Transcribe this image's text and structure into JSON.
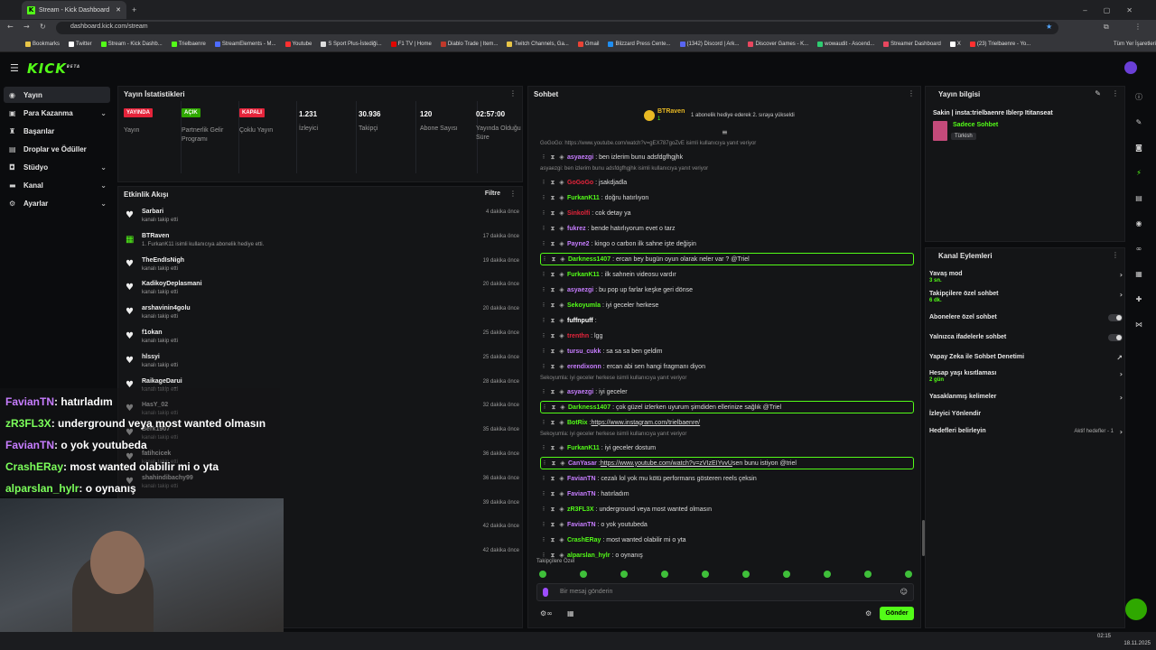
{
  "browser": {
    "tab_title": "Stream - Kick Dashboard",
    "url": "dashboard.kick.com/stream",
    "bookmarks": [
      {
        "label": "Bookmarks",
        "color": "#e8c547"
      },
      {
        "label": "Twitter",
        "color": "#ffffff"
      },
      {
        "label": "Stream - Kick Dashb...",
        "color": "#53fc18"
      },
      {
        "label": "Trielbaenre",
        "color": "#53fc18"
      },
      {
        "label": "StreamElements - M...",
        "color": "#4d6cff"
      },
      {
        "label": "Youtube",
        "color": "#ff3030"
      },
      {
        "label": "S Sport Plus-İstediği...",
        "color": "#dddddd"
      },
      {
        "label": "F1 TV | Home",
        "color": "#e10600"
      },
      {
        "label": "Diablo Trade | Item...",
        "color": "#c0392b"
      },
      {
        "label": "Twitch Channels, Ga...",
        "color": "#e8c547"
      },
      {
        "label": "Gmail",
        "color": "#ea4335"
      },
      {
        "label": "Blizzard Press Cente...",
        "color": "#1f8ef1"
      },
      {
        "label": "(1342) Discord | Ark...",
        "color": "#5865f2"
      },
      {
        "label": "Discover Games - K...",
        "color": "#e8475f"
      },
      {
        "label": "wowaudit - Ascend...",
        "color": "#2ecc71"
      },
      {
        "label": "Streamer Dashboard",
        "color": "#e8475f"
      },
      {
        "label": "X",
        "color": "#ffffff"
      },
      {
        "label": "(23) Trielbaenre - Yo...",
        "color": "#ff3030"
      }
    ],
    "all_bookmarks": "Tüm Yer İşaretleri"
  },
  "brand": {
    "logo": "KICK",
    "logo_sup": "BETA",
    "accent": "#53fc18"
  },
  "sidebar": [
    {
      "label": "Yayın",
      "icon": "broadcast-icon",
      "chevron": false,
      "active": true
    },
    {
      "label": "Para Kazanma",
      "icon": "money-icon",
      "chevron": true
    },
    {
      "label": "Başarılar",
      "icon": "trophy-icon",
      "chevron": false
    },
    {
      "label": "Droplar ve Ödüller",
      "icon": "gift-icon",
      "chevron": false
    },
    {
      "label": "Stüdyo",
      "icon": "camera-icon",
      "chevron": true
    },
    {
      "label": "Kanal",
      "icon": "channel-icon",
      "chevron": true
    },
    {
      "label": "Ayarlar",
      "icon": "gear-icon",
      "chevron": true
    }
  ],
  "stats": {
    "title": "Yayın İstatistikleri",
    "items": [
      {
        "badge": "YAYINDA",
        "badge_color": "#e5243b",
        "label": "Yayın"
      },
      {
        "badge": "AÇIK",
        "badge_color": "#2fa800",
        "label": "Partnerlik Gelir Programı"
      },
      {
        "badge": "KAPALI",
        "badge_color": "#e5243b",
        "label": "Çoklu Yayın"
      },
      {
        "value": "1.231",
        "label": "İzleyici"
      },
      {
        "value": "30.936",
        "label": "Takipçi"
      },
      {
        "value": "120",
        "label": "Abone Sayısı"
      },
      {
        "value": "02:57:00",
        "label": "Yayında Olduğu Süre"
      }
    ]
  },
  "activity": {
    "title": "Etkinlik Akışı",
    "filter": "Filtre",
    "items": [
      {
        "name": "Sarbari",
        "sub": "kanalı takip etti",
        "time": "4 dakika önce",
        "icon": "heart"
      },
      {
        "name": "BTRaven",
        "sub": "1. FurkanK11 isimli kullanıcıya abonelik hediye etti.",
        "time": "17 dakika önce",
        "icon": "gift"
      },
      {
        "name": "TheEndIsNigh",
        "sub": "kanalı takip etti",
        "time": "19 dakika önce",
        "icon": "heart"
      },
      {
        "name": "KadikoyDeplasmani",
        "sub": "kanalı takip etti",
        "time": "20 dakika önce",
        "icon": "heart"
      },
      {
        "name": "arshavinin4golu",
        "sub": "kanalı takip etti",
        "time": "20 dakika önce",
        "icon": "heart"
      },
      {
        "name": "f1okan",
        "sub": "kanalı takip etti",
        "time": "25 dakika önce",
        "icon": "heart"
      },
      {
        "name": "hlssyi",
        "sub": "kanalı takip etti",
        "time": "25 dakika önce",
        "icon": "heart"
      },
      {
        "name": "RaikageDarui",
        "sub": "kanalı takip etti",
        "time": "28 dakika önce",
        "icon": "heart"
      },
      {
        "name": "HasY_02",
        "sub": "kanalı takip etti",
        "time": "32 dakika önce",
        "icon": "heart"
      },
      {
        "name": "Berk1907",
        "sub": "kanalı takip etti",
        "time": "35 dakika önce",
        "icon": "heart"
      },
      {
        "name": "fatihcicek",
        "sub": "kanalı takip etti",
        "time": "36 dakika önce",
        "icon": "heart"
      },
      {
        "name": "shahindibachy99",
        "sub": "kanalı takip etti",
        "time": "36 dakika önce",
        "icon": "heart"
      },
      {
        "name": "",
        "sub": "",
        "time": "39 dakika önce",
        "icon": "heart"
      },
      {
        "name": "",
        "sub": "",
        "time": "42 dakika önce",
        "icon": "heart"
      },
      {
        "name": "",
        "sub": "",
        "time": "42 dakika önce",
        "icon": "heart"
      }
    ]
  },
  "overlay_chat": [
    {
      "user": "FavianTN",
      "color": "#c77dff",
      "text": ": hatırladım"
    },
    {
      "user": "zR3FL3X",
      "color": "#7cff5b",
      "text": ": underground veya most wanted olmasın"
    },
    {
      "user": "FavianTN",
      "color": "#c77dff",
      "text": ": o yok youtubeda"
    },
    {
      "user": "CrashERay",
      "color": "#7cff5b",
      "text": ": most wanted olabilir mi o yta"
    },
    {
      "user": "alparslan_hylr",
      "color": "#7cff5b",
      "text": ": o oynanış"
    }
  ],
  "chat": {
    "title": "Sohbet",
    "top_user": "BTRaven",
    "top_count": "1",
    "top_text": "1 abonelik hediye ederek 2. sıraya yükseldi",
    "messages": [
      {
        "type": "reply",
        "text": "GoGoGo: https://www.youtube.com/watch?v=gEX787goZvE isimli kullanıcıya yanıt veriyor"
      },
      {
        "user": "asyaezgi",
        "color": "#c77dff",
        "text": ": ben izlerim bunu adsfdgfhgjhk"
      },
      {
        "type": "reply",
        "text": "asyaezgi: ben izlerim bunu adsfdgfhgjhk isimli kullanıcıya yanıt veriyor"
      },
      {
        "user": "GoGoGo",
        "color": "#e5243b",
        "text": ": jsakdjadla"
      },
      {
        "user": "FurkanK11",
        "color": "#53fc18",
        "text": ": doğru hatırlıyon"
      },
      {
        "user": "Sinkolfi",
        "color": "#e5243b",
        "text": ": cok detay ya"
      },
      {
        "user": "fukrez",
        "color": "#c77dff",
        "text": ": bende hatırlıyorum evet o tarz"
      },
      {
        "user": "Payne2",
        "color": "#c77dff",
        "text": ": kingo o carbon ilk sahne işte değişin"
      },
      {
        "user": "Darkness1407",
        "color": "#53fc18",
        "text": ": ercan bey bugün oyun olarak neler var ? @Triel",
        "hl": true
      },
      {
        "user": "FurkanK11",
        "color": "#53fc18",
        "text": ": ilk sahnein videosu vardır"
      },
      {
        "user": "asyaezgi",
        "color": "#c77dff",
        "text": ": bu pop up farlar keşke geri dönse"
      },
      {
        "user": "Sekoyumla",
        "color": "#53fc18",
        "text": ": iyi geceler herkese"
      },
      {
        "user": "fuffnpuff",
        "color": "#ffffff",
        "text": ":"
      },
      {
        "user": "trenthn",
        "color": "#e5243b",
        "text": ": lgg"
      },
      {
        "user": "tursu_cukk",
        "color": "#c77dff",
        "text": ": sa sa sa ben geldim"
      },
      {
        "user": "erendixonn",
        "color": "#c77dff",
        "text": ": ercan abi sen hangi fragmanı diyon"
      },
      {
        "type": "reply",
        "text": "Sekoyumla: iyi geceler herkese isimli kullanıcıya yanıt veriyor"
      },
      {
        "user": "asyaezgi",
        "color": "#c77dff",
        "text": ": iyi geceler"
      },
      {
        "user": "Darkness1407",
        "color": "#53fc18",
        "text": ": çok güzel izlerken uyurum şimdiden ellerinize sağlık @Triel",
        "hl": true
      },
      {
        "user": "BotRix",
        "color": "#53fc18",
        "text": ": ",
        "link": "https://www.instagram.com/trielbaenre/"
      },
      {
        "type": "reply",
        "text": "Sekoyumla: iyi geceler herkese isimli kullanıcıya yanıt veriyor"
      },
      {
        "user": "FurkanK11",
        "color": "#53fc18",
        "text": ": iyi geceler dostum"
      },
      {
        "user": "CanYasar",
        "color": "#c77dff",
        "text": ": ",
        "link": "https://www.youtube.com/watch?v=zVIzEIYvvU",
        "after": " sen bunu istiyon @triel",
        "hl": true
      },
      {
        "user": "FavianTN",
        "color": "#c77dff",
        "text": ": cezalı lol yok mu kötü performans gösteren reels çeksin"
      },
      {
        "user": "FavianTN",
        "color": "#c77dff",
        "text": ": hatırladım"
      },
      {
        "user": "zR3FL3X",
        "color": "#53fc18",
        "text": ": underground veya most wanted olmasın"
      },
      {
        "user": "FavianTN",
        "color": "#c77dff",
        "text": ": o yok youtubeda"
      },
      {
        "user": "CrashERay",
        "color": "#53fc18",
        "text": ": most wanted olabilir mi o yta"
      },
      {
        "user": "alparslan_hylr",
        "color": "#53fc18",
        "text": ": o oynanış"
      }
    ],
    "followers_only": "Takipçilere Özel",
    "input_placeholder": "Bir mesaj gönderin",
    "send_label": "Gönder"
  },
  "stream_info": {
    "title": "Yayın bilgisi",
    "stream_title": "Sakin | insta:trielbaenre Iblerp Ititanseat",
    "category": "Sadece Sohbet",
    "language": "Türkish"
  },
  "channel_actions": {
    "title": "Kanal Eylemleri",
    "items": [
      {
        "label": "Yavaş mod",
        "sub": "3 sn.",
        "control": "chevron"
      },
      {
        "label": "Takipçilere özel sohbet",
        "sub": "6 dk.",
        "control": "chevron"
      },
      {
        "label": "Abonelere özel sohbet",
        "control": "toggle"
      },
      {
        "label": "Yalnızca ifadelerle sohbet",
        "control": "toggle"
      },
      {
        "label": "Yapay Zeka ile Sohbet Denetimi",
        "control": "external"
      },
      {
        "label": "Hesap yaşı kısıtlaması",
        "sub": "2 gün",
        "control": "chevron"
      },
      {
        "label": "Yasaklanmış kelimeler",
        "control": "chevron"
      },
      {
        "label": "İzleyici Yönlendir",
        "control": "none"
      },
      {
        "label": "Hedefleri belirleyin",
        "control": "goal",
        "goal_text": "Aktif hedefler - 1"
      }
    ]
  },
  "taskbar": {
    "time": "02:15",
    "date": "18.11.2025"
  }
}
